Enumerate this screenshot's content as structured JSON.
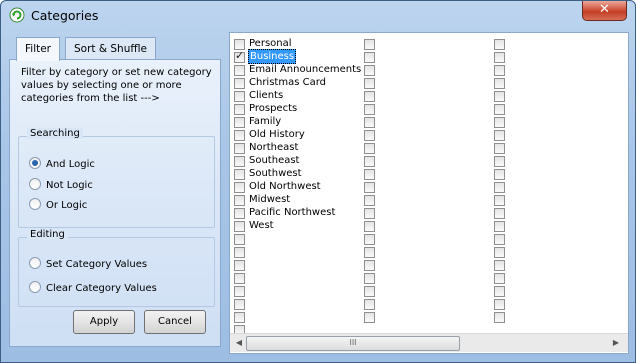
{
  "window": {
    "title": "Categories",
    "close_label": "✕"
  },
  "tabs": [
    {
      "label": "Filter"
    },
    {
      "label": "Sort & Shuffle"
    }
  ],
  "filter": {
    "description": "Filter by category or set new category values by selecting one or more categories from the list --->",
    "searching": {
      "title": "Searching",
      "options": [
        {
          "label": "And Logic",
          "checked": true
        },
        {
          "label": "Not Logic",
          "checked": false
        },
        {
          "label": "Or Logic",
          "checked": false
        }
      ]
    },
    "editing": {
      "title": "Editing",
      "options": [
        {
          "label": "Set Category Values",
          "checked": false
        },
        {
          "label": "Clear Category Values",
          "checked": false
        }
      ]
    },
    "apply_label": "Apply",
    "cancel_label": "Cancel"
  },
  "categories": {
    "column1": [
      {
        "label": "Personal",
        "checked": false,
        "selected": false
      },
      {
        "label": "Business",
        "checked": true,
        "selected": true
      },
      {
        "label": "Email Announcements",
        "checked": false,
        "selected": false
      },
      {
        "label": "Christmas Card",
        "checked": false,
        "selected": false
      },
      {
        "label": "Clients",
        "checked": false,
        "selected": false
      },
      {
        "label": "Prospects",
        "checked": false,
        "selected": false
      },
      {
        "label": "Family",
        "checked": false,
        "selected": false
      },
      {
        "label": "Old History",
        "checked": false,
        "selected": false
      },
      {
        "label": "Northeast",
        "checked": false,
        "selected": false
      },
      {
        "label": "Southeast",
        "checked": false,
        "selected": false
      },
      {
        "label": "Southwest",
        "checked": false,
        "selected": false
      },
      {
        "label": "Old Northwest",
        "checked": false,
        "selected": false
      },
      {
        "label": "Midwest",
        "checked": false,
        "selected": false
      },
      {
        "label": "Pacific Northwest",
        "checked": false,
        "selected": false
      },
      {
        "label": "West",
        "checked": false,
        "selected": false
      }
    ],
    "empty_rows_col1": 8,
    "rows_col2": 22,
    "rows_col3": 22
  },
  "scrollbar": {
    "left_arrow": "◀",
    "right_arrow": "▶",
    "thumb_grip": "III"
  },
  "icons": {
    "app": "refresh-circle-icon",
    "close": "close-icon"
  }
}
